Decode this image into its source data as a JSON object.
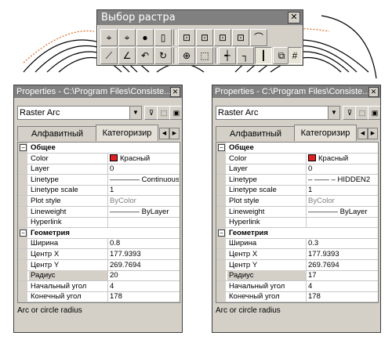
{
  "toolbar": {
    "title": "Выбор растра",
    "close_glyph": "✕",
    "row1_icons": [
      "raster-pick-icon-1",
      "raster-pick-icon-2",
      "raster-fill-icon",
      "raster-page-icon",
      "raster-sel-icon-1",
      "raster-sel-icon-2",
      "raster-sel-icon-3",
      "raster-sel-icon-4",
      "raster-sel-icon-5"
    ],
    "row2_icons": [
      "line-tool-icon",
      "arc-tool-icon",
      "circle-tool-icon",
      "rotate-tool-icon",
      "zoom-tool-icon",
      "bbox-tool-icon",
      "trim-tool-icon",
      "extend-tool-icon",
      "split-tool-icon",
      "move-tool-icon",
      "grid-tool-icon"
    ]
  },
  "panels": [
    {
      "title": "Properties - C:\\Program Files\\Consiste...",
      "object_type": "Raster Arc",
      "tabs": {
        "alphabetic": "Алфавитный",
        "categorized": "Категоризир"
      },
      "rows": [
        {
          "type": "cat",
          "label": "Общее"
        },
        {
          "label": "Color",
          "value": "Красный",
          "swatch": "#e02020"
        },
        {
          "label": "Layer",
          "value": "0"
        },
        {
          "label": "Linetype",
          "value": "———— Continuous"
        },
        {
          "label": "Linetype scale",
          "value": "1"
        },
        {
          "label": "Plot style",
          "value": "ByColor",
          "grey": true
        },
        {
          "label": "Lineweight",
          "value": "———— ByLayer"
        },
        {
          "label": "Hyperlink",
          "value": ""
        },
        {
          "type": "cat",
          "label": "Геометрия"
        },
        {
          "label": "Ширина",
          "value": "0.8"
        },
        {
          "label": "Центр X",
          "value": "177.9393"
        },
        {
          "label": "Центр Y",
          "value": "269.7694"
        },
        {
          "label": "Радиус",
          "value": "20",
          "selected": true
        },
        {
          "label": "Начальный угол",
          "value": "4"
        },
        {
          "label": "Конечный угол",
          "value": "178"
        }
      ],
      "description": "Arc or circle radius"
    },
    {
      "title": "Properties - C:\\Program Files\\Consiste...",
      "object_type": "Raster Arc",
      "tabs": {
        "alphabetic": "Алфавитный",
        "categorized": "Категоризир"
      },
      "rows": [
        {
          "type": "cat",
          "label": "Общее"
        },
        {
          "label": "Color",
          "value": "Красный",
          "swatch": "#e02020"
        },
        {
          "label": "Layer",
          "value": "0"
        },
        {
          "label": "Linetype",
          "value": "– —— – HIDDEN2"
        },
        {
          "label": "Linetype scale",
          "value": "1"
        },
        {
          "label": "Plot style",
          "value": "ByColor",
          "grey": true
        },
        {
          "label": "Lineweight",
          "value": "———— ByLayer"
        },
        {
          "label": "Hyperlink",
          "value": ""
        },
        {
          "type": "cat",
          "label": "Геометрия"
        },
        {
          "label": "Ширина",
          "value": "0.3"
        },
        {
          "label": "Центр X",
          "value": "177.9393"
        },
        {
          "label": "Центр Y",
          "value": "269.7694"
        },
        {
          "label": "Радиус",
          "value": "17",
          "selected": true
        },
        {
          "label": "Начальный угол",
          "value": "4"
        },
        {
          "label": "Конечный угол",
          "value": "178"
        }
      ],
      "description": "Arc or circle radius"
    }
  ]
}
